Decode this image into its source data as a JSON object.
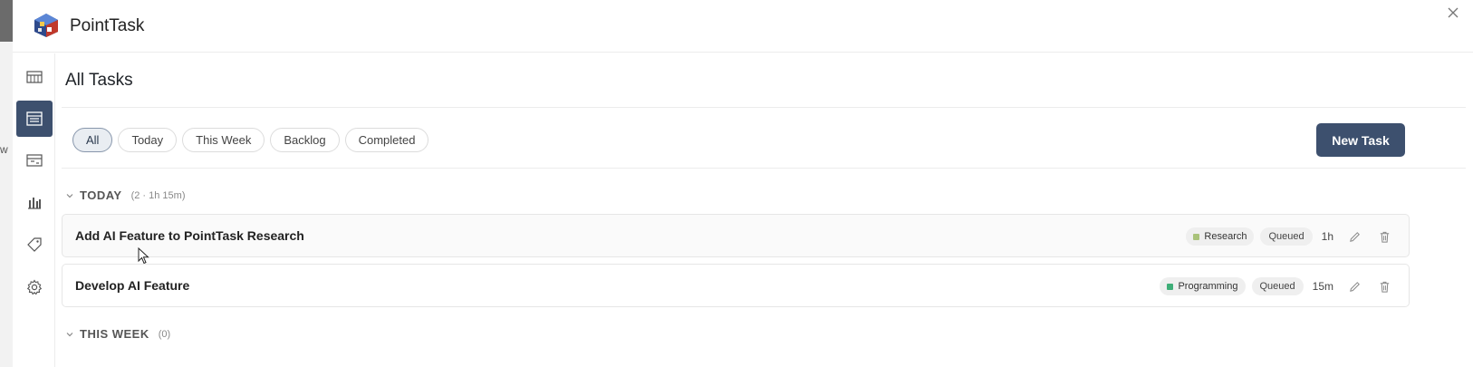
{
  "app": {
    "title": "PointTask",
    "edge_letter": "w"
  },
  "sidebar": {
    "items": [
      {
        "icon": "board-icon",
        "active": false
      },
      {
        "icon": "task-list-icon",
        "active": true
      },
      {
        "icon": "calendar-icon",
        "active": false
      },
      {
        "icon": "bar-chart-icon",
        "active": false
      },
      {
        "icon": "tag-icon",
        "active": false
      },
      {
        "icon": "gear-icon",
        "active": false
      }
    ]
  },
  "main": {
    "title": "All Tasks",
    "filters": [
      "All",
      "Today",
      "This Week",
      "Backlog",
      "Completed"
    ],
    "active_filter": "All",
    "new_task_label": "New Task"
  },
  "sections": [
    {
      "label": "TODAY",
      "meta": "(2 · 1h 15m)",
      "tasks": [
        {
          "title": "Add AI Feature to PointTask Research",
          "tag": "Research",
          "tag_color": "#a9c27a",
          "status": "Queued",
          "duration": "1h"
        },
        {
          "title": "Develop AI Feature",
          "tag": "Programming",
          "tag_color": "#3fae78",
          "status": "Queued",
          "duration": "15m"
        }
      ]
    },
    {
      "label": "THIS WEEK",
      "meta": "(0)",
      "tasks": []
    }
  ],
  "colors": {
    "accent": "#3d506e",
    "border": "#e6e6e6",
    "pill_bg": "#efefef"
  }
}
